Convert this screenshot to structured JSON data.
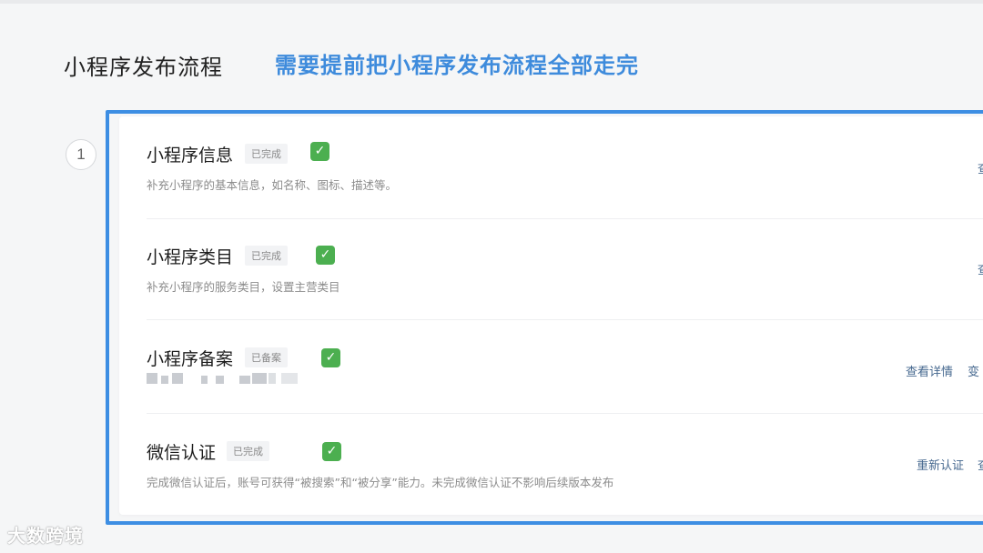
{
  "page": {
    "title": "小程序发布流程",
    "annotation": "需要提前把小程序发布流程全部走完",
    "step_number": "1"
  },
  "items": [
    {
      "name": "小程序信息",
      "badge": "已完成",
      "check_icon": "check-mark-icon",
      "description": "补充小程序的基本信息，如名称、图标、描述等。",
      "actions": [
        "查"
      ]
    },
    {
      "name": "小程序类目",
      "badge": "已完成",
      "check_icon": "check-mark-icon",
      "description": "补充小程序的服务类目，设置主营类目",
      "actions": [
        "查"
      ]
    },
    {
      "name": "小程序备案",
      "badge": "已备案",
      "check_icon": "check-mark-icon",
      "description": "",
      "actions": [
        "查看详情",
        "变"
      ]
    },
    {
      "name": "微信认证",
      "badge": "已完成",
      "check_icon": "check-mark-icon",
      "description": "完成微信认证后，账号可获得“被搜索”和“被分享”能力。未完成微信认证不影响后续版本发布",
      "actions": [
        "重新认证",
        "查"
      ]
    }
  ],
  "watermark": "大数跨境",
  "colors": {
    "annotation": "#3e8bdc",
    "highlight_frame": "#3d8ee3",
    "check": "#4caf50",
    "action_link": "#46688f"
  }
}
